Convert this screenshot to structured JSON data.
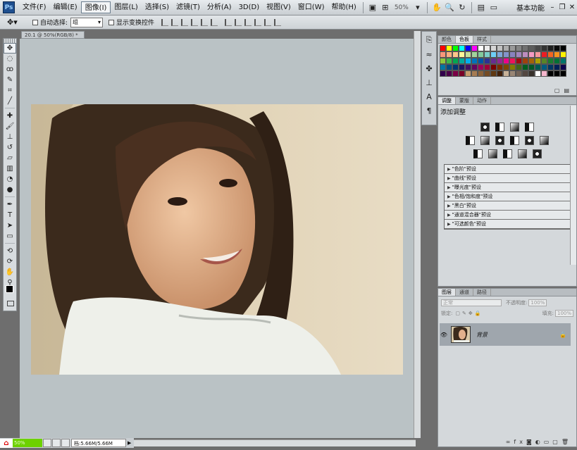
{
  "app": {
    "logo": "Ps"
  },
  "menu": [
    "文件(F)",
    "编辑(E)",
    "图像(I)",
    "图层(L)",
    "选择(S)",
    "滤镜(T)",
    "分析(A)",
    "3D(D)",
    "视图(V)",
    "窗口(W)",
    "帮助(H)"
  ],
  "menu_active_index": 2,
  "appbar": {
    "zoom": "50%",
    "workspace": "基本功能"
  },
  "options": {
    "auto_select": "自动选择:",
    "auto_select_value": "组",
    "show_transform": "显示变换控件"
  },
  "document": {
    "tab_title": "20.1 @ 50%(RGB/8) *"
  },
  "status": {
    "zoom": "50%",
    "info": "档:5.66M/5.66M"
  },
  "swatches_panel": {
    "tabs": [
      "颜色",
      "色板",
      "样式"
    ],
    "active_tab": 1,
    "colors": [
      "#ff0000",
      "#ffff00",
      "#00ff00",
      "#00ffff",
      "#0000ff",
      "#ff00ff",
      "#ffffff",
      "#ebebeb",
      "#d6d6d6",
      "#c2c2c2",
      "#adadad",
      "#999999",
      "#858585",
      "#707070",
      "#5c5c5c",
      "#474747",
      "#333333",
      "#1f1f1f",
      "#0a0a0a",
      "#000000",
      "#f7977a",
      "#f9ad81",
      "#fdc68a",
      "#fff79a",
      "#c4df9b",
      "#a2d39c",
      "#82ca9d",
      "#7bcdc8",
      "#6ecff6",
      "#7ea7d8",
      "#8493ca",
      "#8882be",
      "#a187be",
      "#bc8dbf",
      "#f49ac2",
      "#f6989d",
      "#ed1c24",
      "#f26522",
      "#f7941d",
      "#fff200",
      "#8dc63f",
      "#39b54a",
      "#00a651",
      "#00a99d",
      "#00aeef",
      "#0072bc",
      "#0054a6",
      "#2e3192",
      "#662d91",
      "#92278f",
      "#ec008c",
      "#ed145b",
      "#9e0b0f",
      "#a0410d",
      "#a36209",
      "#aba000",
      "#598527",
      "#1a7b30",
      "#007236",
      "#00746b",
      "#0076a3",
      "#004b80",
      "#003471",
      "#1b1464",
      "#440e62",
      "#630460",
      "#9e005d",
      "#9e0039",
      "#790000",
      "#7b2e00",
      "#7d4900",
      "#827b00",
      "#406618",
      "#005e20",
      "#005826",
      "#005952",
      "#005b7f",
      "#003663",
      "#002157",
      "#0d004c",
      "#32004b",
      "#4b0049",
      "#7b0046",
      "#7a0026",
      "#c69c6d",
      "#a67c52",
      "#8c6239",
      "#754c24",
      "#603913",
      "#42210b",
      "#c7b299",
      "#998675",
      "#736357",
      "#534741",
      "#37302a",
      "#ffffff",
      "#f5b6cd",
      "#000000",
      "#000000",
      "#000000"
    ]
  },
  "adjust_panel": {
    "tabs": [
      "调整",
      "蒙版",
      "动作"
    ],
    "active_tab": 0,
    "title": "添加调整",
    "presets": [
      "\"色阶\"预设",
      "\"曲线\"预设",
      "\"曝光度\"预设",
      "\"色相/饱和度\"预设",
      "\"黑白\"预设",
      "\"通道混合器\"预设",
      "\"可选颜色\"预设"
    ]
  },
  "layers_panel": {
    "tabs": [
      "图层",
      "通道",
      "路径"
    ],
    "active_tab": 0,
    "blend_mode": "正常",
    "opacity_label": "不透明度:",
    "opacity": "100%",
    "lock_label": "锁定:",
    "fill_label": "填充:",
    "fill": "100%",
    "layer_name": "背景"
  }
}
